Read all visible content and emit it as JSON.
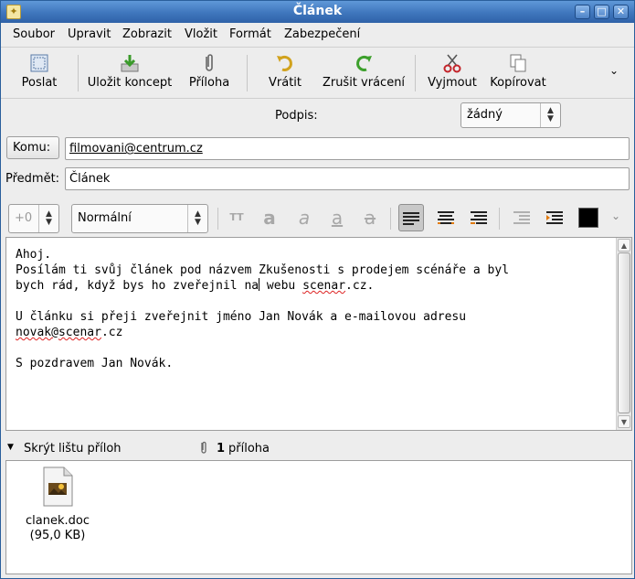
{
  "window": {
    "title": "Článek"
  },
  "menu": [
    "Soubor",
    "Upravit",
    "Zobrazit",
    "Vložit",
    "Formát",
    "Zabezpečení"
  ],
  "toolbar": {
    "send": "Poslat",
    "save": "Uložit koncept",
    "attach": "Příloha",
    "undo": "Vrátit",
    "redo": "Zrušit vrácení",
    "cut": "Vyjmout",
    "copy": "Kopírovat"
  },
  "signature": {
    "label": "Podpis:",
    "value": "žádný"
  },
  "to": {
    "label": "Komu:",
    "value": "filmovani@centrum.cz"
  },
  "subject": {
    "label": "Předmět:",
    "value": "Článek"
  },
  "format": {
    "size": "+0",
    "style": "Normální",
    "color": "#000000"
  },
  "body": {
    "line1": "Ahoj.",
    "line2": "Posílám ti svůj článek pod názvem Zkušenosti s prodejem scénáře a byl",
    "line3a": "bych rád, když bys ho zveřejnil na",
    "line3b": " webu ",
    "line3c": "scenar",
    "line3d": ".cz.",
    "line4": "U článku si přeji zveřejnit jméno Jan Novák a e-mailovou adresu",
    "line5a": "novak@",
    "line5b": "scenar",
    "line5c": ".cz",
    "line6": "S pozdravem Jan Novák."
  },
  "attachments": {
    "toggle": "Skrýt lištu příloh",
    "count": "1",
    "count_label": "příloha",
    "items": [
      {
        "name": "clanek.doc",
        "size": "(95,0 KB)"
      }
    ]
  }
}
